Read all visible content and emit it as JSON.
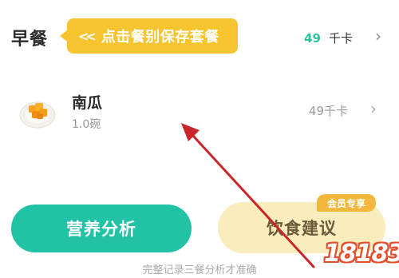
{
  "meal": {
    "title": "早餐",
    "tooltip": "点击餐别保存套餐",
    "tooltip_icon": "double-chevron-left-icon",
    "calories": "49",
    "calorie_unit": "千卡"
  },
  "food_items": [
    {
      "name": "南瓜",
      "portion": "1.0碗",
      "calories": "49千卡",
      "image": "pumpkin-dish"
    }
  ],
  "actions": {
    "analysis_label": "营养分析",
    "advice_label": "饮食建议",
    "vip_badge": "会员专享",
    "footer_note": "完整记录三餐分析才准确"
  },
  "watermark": "18183",
  "colors": {
    "accent_green": "#22c2a6",
    "tooltip_yellow": "#f6c42f",
    "advice_bg": "#faedbd",
    "arrow_red": "#c8262a"
  }
}
